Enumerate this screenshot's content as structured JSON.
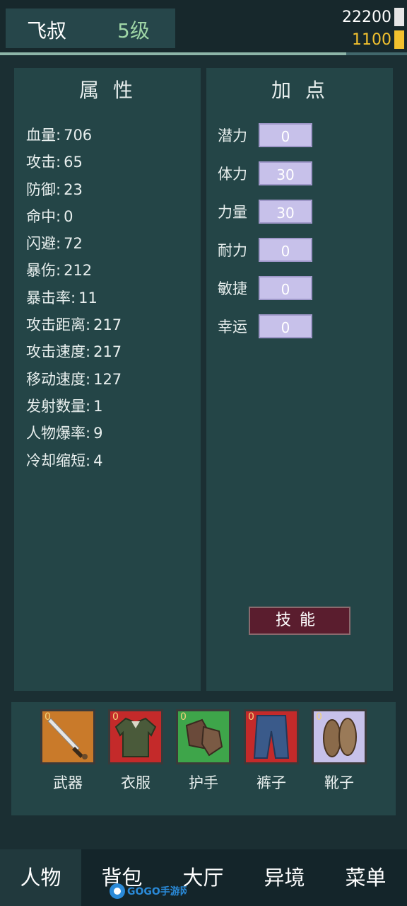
{
  "header": {
    "player_name": "飞叔",
    "level": "5级",
    "resource1": "22200",
    "resource2": "1100",
    "progress": 0.85
  },
  "attributes": {
    "title": "属性",
    "rows": [
      {
        "label": "血量:",
        "value": "706"
      },
      {
        "label": "攻击:",
        "value": "65"
      },
      {
        "label": "防御:",
        "value": "23"
      },
      {
        "label": "命中:",
        "value": "0"
      },
      {
        "label": "闪避:",
        "value": "72"
      },
      {
        "label": "暴伤:",
        "value": "212"
      },
      {
        "label": "暴击率:",
        "value": "11"
      },
      {
        "label": "攻击距离:",
        "value": "217"
      },
      {
        "label": "攻击速度:",
        "value": "217"
      },
      {
        "label": "移动速度:",
        "value": "127"
      },
      {
        "label": "发射数量:",
        "value": "1"
      },
      {
        "label": "人物爆率:",
        "value": "9"
      },
      {
        "label": "冷却缩短:",
        "value": "4"
      }
    ]
  },
  "points": {
    "title": "加点",
    "rows": [
      {
        "label": "潜力",
        "value": "0"
      },
      {
        "label": "体力",
        "value": "30"
      },
      {
        "label": "力量",
        "value": "30"
      },
      {
        "label": "耐力",
        "value": "0"
      },
      {
        "label": "敏捷",
        "value": "0"
      },
      {
        "label": "幸运",
        "value": "0"
      }
    ],
    "skill_button": "技能"
  },
  "equipment": [
    {
      "label": "武器",
      "count": "0",
      "icon": "sword-icon",
      "bg": "#c97a2a"
    },
    {
      "label": "衣服",
      "count": "0",
      "icon": "jacket-icon",
      "bg": "#c42a2a"
    },
    {
      "label": "护手",
      "count": "0",
      "icon": "gloves-icon",
      "bg": "#3ea54a"
    },
    {
      "label": "裤子",
      "count": "0",
      "icon": "pants-icon",
      "bg": "#c42a2a"
    },
    {
      "label": "靴子",
      "count": "0",
      "icon": "sandals-icon",
      "bg": "#c7c1ea"
    }
  ],
  "nav": [
    {
      "label": "人物",
      "active": true
    },
    {
      "label": "背包",
      "active": false
    },
    {
      "label": "大厅",
      "active": false
    },
    {
      "label": "异境",
      "active": false
    },
    {
      "label": "菜单",
      "active": false
    }
  ],
  "watermark": "GOGO手游网"
}
